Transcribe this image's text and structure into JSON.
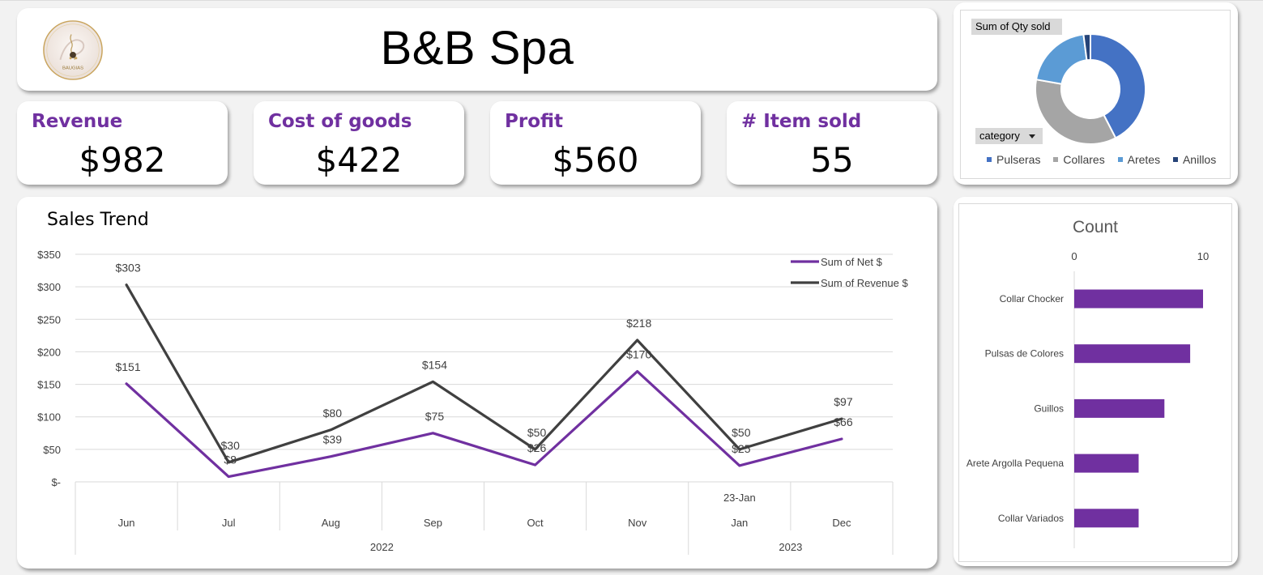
{
  "header": {
    "title": "B&B Spa",
    "logo_text": "BAUGIAS"
  },
  "kpis": [
    {
      "label": "Revenue",
      "value": "$982"
    },
    {
      "label": "Cost of goods",
      "value": "$422"
    },
    {
      "label": "Profit",
      "value": "$560"
    },
    {
      "label": "# Item sold",
      "value": "55"
    }
  ],
  "donut": {
    "field_button": "Sum of Qty sold",
    "category_button": "category",
    "dropdown_icon": "triangle-down-icon",
    "legend": [
      "Pulseras",
      "Collares",
      "Aretes",
      "Anillos"
    ],
    "colors": [
      "#4472c4",
      "#a5a5a5",
      "#5b9bd5",
      "#264478"
    ]
  },
  "chart_data": [
    {
      "type": "line",
      "title": "Sales Trend",
      "categories": [
        "Jun",
        "Jul",
        "Aug",
        "Sep",
        "Oct",
        "Nov",
        "Jan",
        "Dec"
      ],
      "sub_labels": [
        "",
        "",
        "",
        "",
        "",
        "",
        "23-Jan",
        ""
      ],
      "year_groups": [
        {
          "label": "2022",
          "start": 0,
          "end": 5
        },
        {
          "label": "2023",
          "start": 6,
          "end": 7
        }
      ],
      "yticks": [
        "$-",
        "$50",
        "$100",
        "$150",
        "$200",
        "$250",
        "$300",
        "$350"
      ],
      "ylim": [
        0,
        350
      ],
      "legend_position": "top-right",
      "series": [
        {
          "name": "Sum of Net $",
          "color": "#7030a0",
          "values": [
            151,
            8,
            39,
            75,
            26,
            170,
            25,
            66
          ],
          "labels": [
            "$151",
            "$8",
            "$39",
            "$75",
            "$26",
            "$170",
            "$25",
            "$66"
          ]
        },
        {
          "name": "Sum of Revenue $",
          "color": "#404040",
          "values": [
            303,
            30,
            80,
            154,
            50,
            218,
            50,
            97
          ],
          "labels": [
            "$303",
            "$30",
            "$80",
            "$154",
            "$50",
            "$218",
            "$50",
            "$97"
          ]
        }
      ]
    },
    {
      "type": "bar",
      "title": "Count",
      "orientation": "horizontal",
      "categories": [
        "Collar Chocker",
        "Pulsas de Colores",
        "Guillos",
        "Arete Argolla Pequena",
        "Collar Variados"
      ],
      "values": [
        10,
        9,
        7,
        5,
        5
      ],
      "xticks": [
        "0",
        "10"
      ],
      "xlim": [
        0,
        10
      ],
      "color": "#7030a0"
    },
    {
      "type": "pie",
      "categories": [
        "Pulseras",
        "Collares",
        "Aretes",
        "Anillos"
      ],
      "values": [
        42,
        35,
        20,
        2
      ]
    }
  ]
}
